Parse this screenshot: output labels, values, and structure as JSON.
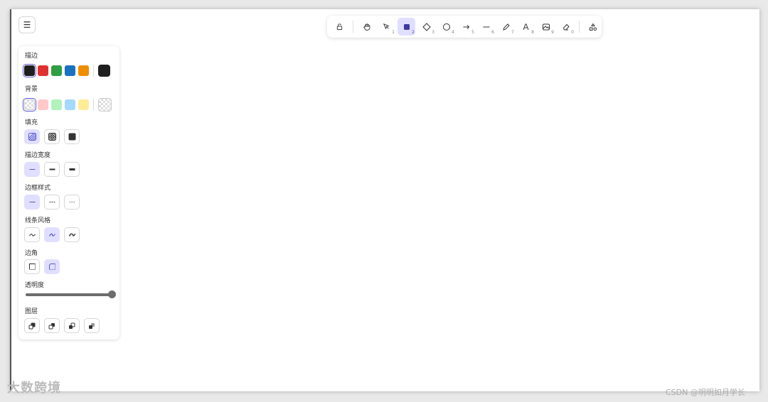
{
  "toolbar": {
    "tools": [
      {
        "name": "lock",
        "key": ""
      },
      {
        "name": "hand",
        "key": ""
      },
      {
        "name": "selection",
        "key": "1"
      },
      {
        "name": "rectangle",
        "key": "2",
        "active": true
      },
      {
        "name": "diamond",
        "key": "3"
      },
      {
        "name": "ellipse",
        "key": "4"
      },
      {
        "name": "arrow",
        "key": "5"
      },
      {
        "name": "line",
        "key": "6"
      },
      {
        "name": "draw",
        "key": "7"
      },
      {
        "name": "text",
        "key": "8"
      },
      {
        "name": "image",
        "key": "9"
      },
      {
        "name": "eraser",
        "key": "0"
      },
      {
        "name": "library",
        "key": ""
      }
    ]
  },
  "panel": {
    "stroke_label": "描边",
    "background_label": "背景",
    "fill_label": "填充",
    "stroke_width_label": "描边宽度",
    "stroke_style_label": "边框样式",
    "sloppiness_label": "线条风格",
    "edges_label": "边角",
    "opacity_label": "透明度",
    "opacity_value": 100,
    "layers_label": "图层",
    "stroke_colors": [
      "#1e1e1e",
      "#e03131",
      "#2f9e44",
      "#1971c2",
      "#f08c00"
    ],
    "stroke_current": "#1e1e1e",
    "background_colors": [
      "transparent",
      "#ffc9c9",
      "#b2f2bb",
      "#a5d8ff",
      "#ffec99"
    ],
    "background_current": "transparent",
    "accent": "#5b57d1",
    "active_bg": "#e0dfff"
  },
  "watermark": {
    "left": "大数跨境",
    "right": "CSDN @明明如月学长"
  }
}
